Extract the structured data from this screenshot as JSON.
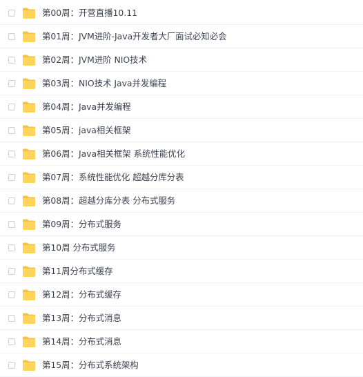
{
  "icons": {
    "folder": "folder-icon",
    "checkbox": "checkbox"
  },
  "colors": {
    "folder_body": "#ffd45a",
    "folder_tab": "#f7c13f",
    "text": "#3b4250"
  },
  "files": [
    {
      "name": "第00周：开营直播10.11"
    },
    {
      "name": "第01周：JVM进阶-Java开发者大厂面试必知必会"
    },
    {
      "name": "第02周：JVM进阶 NIO技术"
    },
    {
      "name": "第03周：NIO技术 Java并发编程"
    },
    {
      "name": "第04周：Java并发编程"
    },
    {
      "name": "第05周：java相关框架"
    },
    {
      "name": "第06周：Java相关框架 系统性能优化"
    },
    {
      "name": "第07周：系统性能优化 超越分库分表"
    },
    {
      "name": "第08周：超越分库分表 分布式服务"
    },
    {
      "name": "第09周：分布式服务"
    },
    {
      "name": "第10周 分布式服务"
    },
    {
      "name": "第11周分布式缓存"
    },
    {
      "name": "第12周：分布式缓存"
    },
    {
      "name": "第13周：分布式消息"
    },
    {
      "name": "第14周：分布式消息"
    },
    {
      "name": "第15周：分布式系统架构"
    }
  ]
}
